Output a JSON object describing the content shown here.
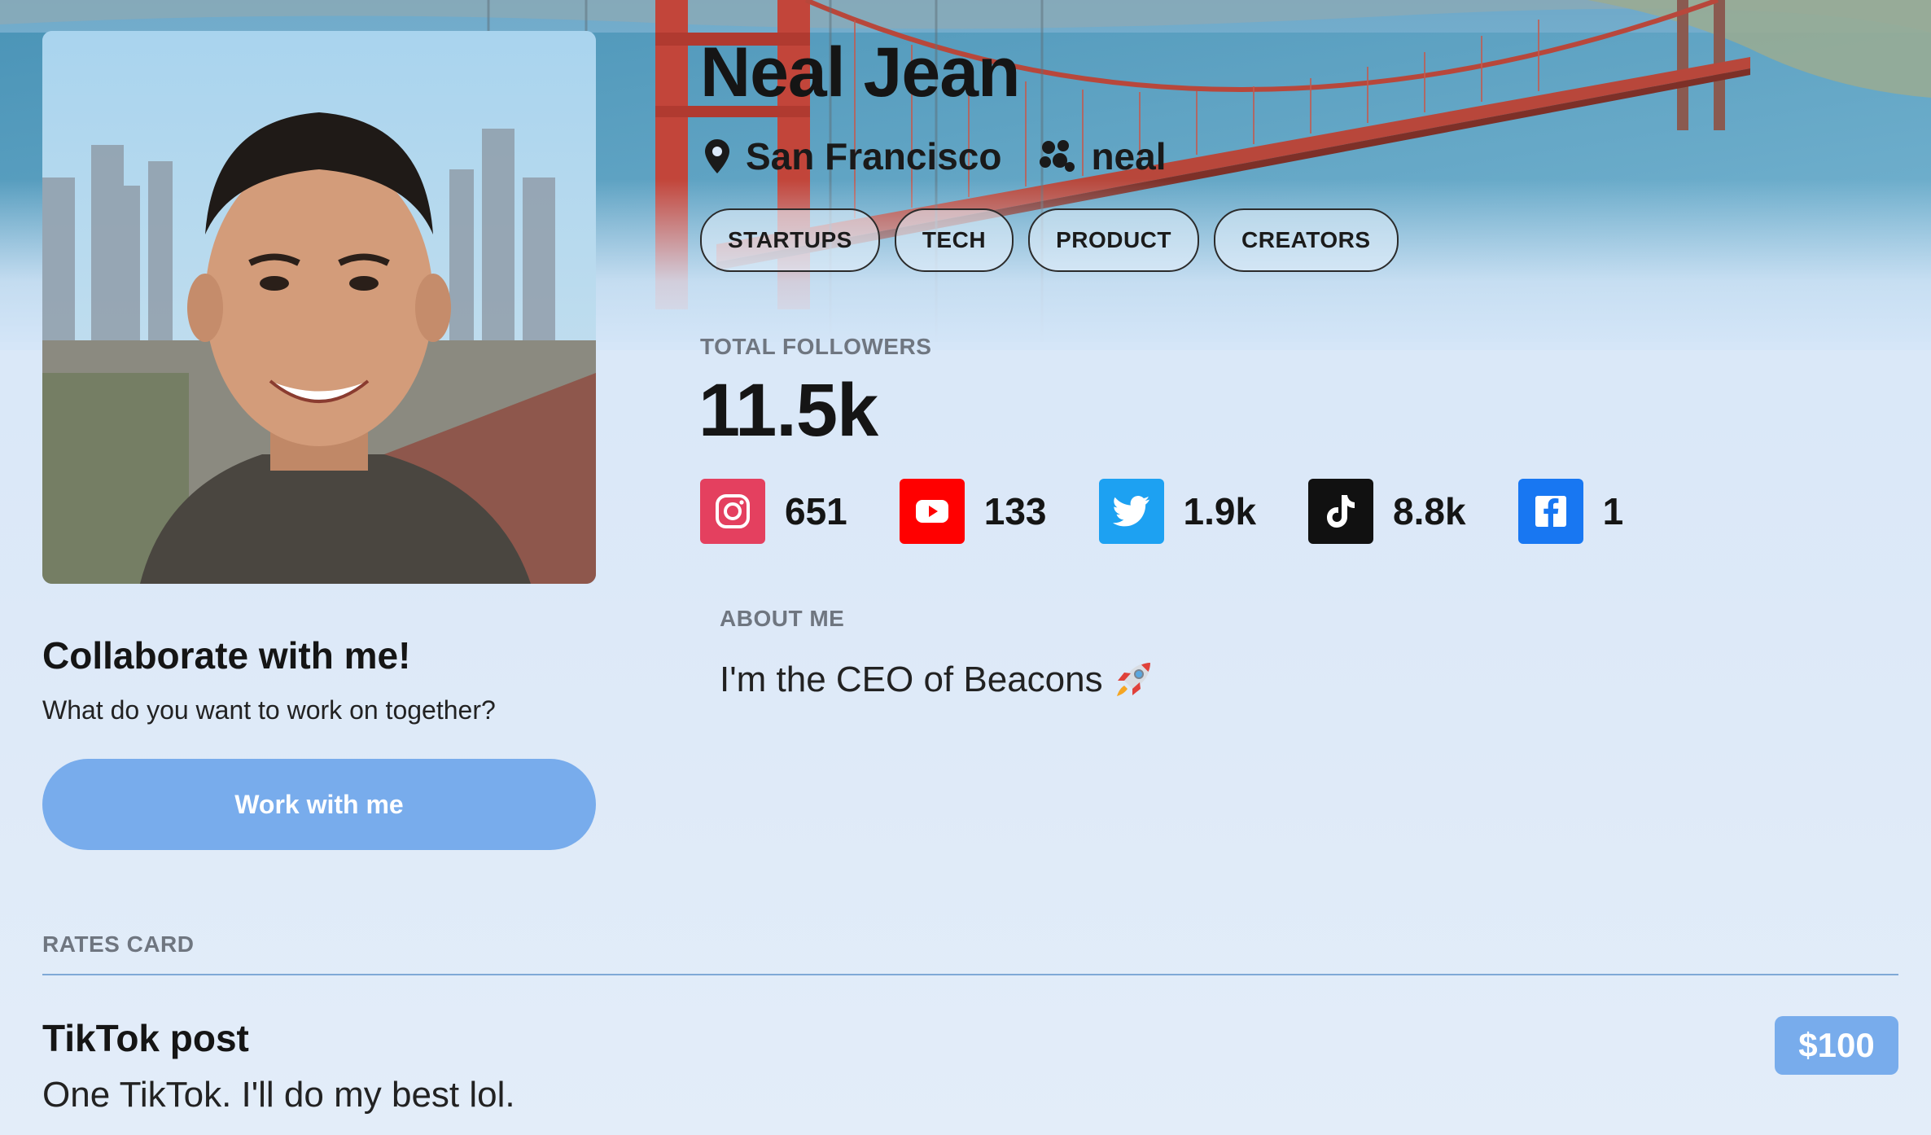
{
  "profile": {
    "name": "Neal Jean",
    "location": "San Francisco",
    "handle": "neal",
    "tags": [
      "STARTUPS",
      "TECH",
      "PRODUCT",
      "CREATORS"
    ]
  },
  "followers": {
    "label": "TOTAL FOLLOWERS",
    "total": "11.5k",
    "platforms": [
      {
        "platform": "instagram",
        "icon": "instagram-icon",
        "count": "651",
        "color": "#e4405f"
      },
      {
        "platform": "youtube",
        "icon": "youtube-icon",
        "count": "133",
        "color": "#ff0000"
      },
      {
        "platform": "twitter",
        "icon": "twitter-icon",
        "count": "1.9k",
        "color": "#1da1f2"
      },
      {
        "platform": "tiktok",
        "icon": "tiktok-icon",
        "count": "8.8k",
        "color": "#111111"
      },
      {
        "platform": "facebook",
        "icon": "facebook-icon",
        "count": "1",
        "color": "#1877f2"
      }
    ]
  },
  "about": {
    "label": "ABOUT ME",
    "text": "I'm the CEO of Beacons",
    "emoji_icon": "rocket-icon"
  },
  "collaborate": {
    "title": "Collaborate with me!",
    "subtitle": "What do you want to work on together?",
    "button_label": "Work with me"
  },
  "rates": {
    "label": "RATES CARD",
    "items": [
      {
        "title": "TikTok post",
        "description": "One TikTok. I'll do my best lol.",
        "price": "$100"
      }
    ]
  },
  "colors": {
    "accent": "#78acec",
    "background": "#dbe9f9",
    "divider": "#7fa9d6"
  }
}
